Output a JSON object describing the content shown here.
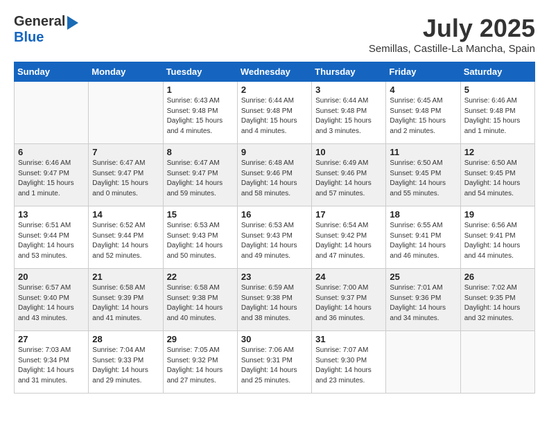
{
  "logo": {
    "general": "General",
    "blue": "Blue"
  },
  "title": {
    "month_year": "July 2025",
    "location": "Semillas, Castille-La Mancha, Spain"
  },
  "days_of_week": [
    "Sunday",
    "Monday",
    "Tuesday",
    "Wednesday",
    "Thursday",
    "Friday",
    "Saturday"
  ],
  "weeks": [
    [
      {
        "day": "",
        "info": ""
      },
      {
        "day": "",
        "info": ""
      },
      {
        "day": "1",
        "info": "Sunrise: 6:43 AM\nSunset: 9:48 PM\nDaylight: 15 hours\nand 4 minutes."
      },
      {
        "day": "2",
        "info": "Sunrise: 6:44 AM\nSunset: 9:48 PM\nDaylight: 15 hours\nand 4 minutes."
      },
      {
        "day": "3",
        "info": "Sunrise: 6:44 AM\nSunset: 9:48 PM\nDaylight: 15 hours\nand 3 minutes."
      },
      {
        "day": "4",
        "info": "Sunrise: 6:45 AM\nSunset: 9:48 PM\nDaylight: 15 hours\nand 2 minutes."
      },
      {
        "day": "5",
        "info": "Sunrise: 6:46 AM\nSunset: 9:48 PM\nDaylight: 15 hours\nand 1 minute."
      }
    ],
    [
      {
        "day": "6",
        "info": "Sunrise: 6:46 AM\nSunset: 9:47 PM\nDaylight: 15 hours\nand 1 minute."
      },
      {
        "day": "7",
        "info": "Sunrise: 6:47 AM\nSunset: 9:47 PM\nDaylight: 15 hours\nand 0 minutes."
      },
      {
        "day": "8",
        "info": "Sunrise: 6:47 AM\nSunset: 9:47 PM\nDaylight: 14 hours\nand 59 minutes."
      },
      {
        "day": "9",
        "info": "Sunrise: 6:48 AM\nSunset: 9:46 PM\nDaylight: 14 hours\nand 58 minutes."
      },
      {
        "day": "10",
        "info": "Sunrise: 6:49 AM\nSunset: 9:46 PM\nDaylight: 14 hours\nand 57 minutes."
      },
      {
        "day": "11",
        "info": "Sunrise: 6:50 AM\nSunset: 9:45 PM\nDaylight: 14 hours\nand 55 minutes."
      },
      {
        "day": "12",
        "info": "Sunrise: 6:50 AM\nSunset: 9:45 PM\nDaylight: 14 hours\nand 54 minutes."
      }
    ],
    [
      {
        "day": "13",
        "info": "Sunrise: 6:51 AM\nSunset: 9:44 PM\nDaylight: 14 hours\nand 53 minutes."
      },
      {
        "day": "14",
        "info": "Sunrise: 6:52 AM\nSunset: 9:44 PM\nDaylight: 14 hours\nand 52 minutes."
      },
      {
        "day": "15",
        "info": "Sunrise: 6:53 AM\nSunset: 9:43 PM\nDaylight: 14 hours\nand 50 minutes."
      },
      {
        "day": "16",
        "info": "Sunrise: 6:53 AM\nSunset: 9:43 PM\nDaylight: 14 hours\nand 49 minutes."
      },
      {
        "day": "17",
        "info": "Sunrise: 6:54 AM\nSunset: 9:42 PM\nDaylight: 14 hours\nand 47 minutes."
      },
      {
        "day": "18",
        "info": "Sunrise: 6:55 AM\nSunset: 9:41 PM\nDaylight: 14 hours\nand 46 minutes."
      },
      {
        "day": "19",
        "info": "Sunrise: 6:56 AM\nSunset: 9:41 PM\nDaylight: 14 hours\nand 44 minutes."
      }
    ],
    [
      {
        "day": "20",
        "info": "Sunrise: 6:57 AM\nSunset: 9:40 PM\nDaylight: 14 hours\nand 43 minutes."
      },
      {
        "day": "21",
        "info": "Sunrise: 6:58 AM\nSunset: 9:39 PM\nDaylight: 14 hours\nand 41 minutes."
      },
      {
        "day": "22",
        "info": "Sunrise: 6:58 AM\nSunset: 9:38 PM\nDaylight: 14 hours\nand 40 minutes."
      },
      {
        "day": "23",
        "info": "Sunrise: 6:59 AM\nSunset: 9:38 PM\nDaylight: 14 hours\nand 38 minutes."
      },
      {
        "day": "24",
        "info": "Sunrise: 7:00 AM\nSunset: 9:37 PM\nDaylight: 14 hours\nand 36 minutes."
      },
      {
        "day": "25",
        "info": "Sunrise: 7:01 AM\nSunset: 9:36 PM\nDaylight: 14 hours\nand 34 minutes."
      },
      {
        "day": "26",
        "info": "Sunrise: 7:02 AM\nSunset: 9:35 PM\nDaylight: 14 hours\nand 32 minutes."
      }
    ],
    [
      {
        "day": "27",
        "info": "Sunrise: 7:03 AM\nSunset: 9:34 PM\nDaylight: 14 hours\nand 31 minutes."
      },
      {
        "day": "28",
        "info": "Sunrise: 7:04 AM\nSunset: 9:33 PM\nDaylight: 14 hours\nand 29 minutes."
      },
      {
        "day": "29",
        "info": "Sunrise: 7:05 AM\nSunset: 9:32 PM\nDaylight: 14 hours\nand 27 minutes."
      },
      {
        "day": "30",
        "info": "Sunrise: 7:06 AM\nSunset: 9:31 PM\nDaylight: 14 hours\nand 25 minutes."
      },
      {
        "day": "31",
        "info": "Sunrise: 7:07 AM\nSunset: 9:30 PM\nDaylight: 14 hours\nand 23 minutes."
      },
      {
        "day": "",
        "info": ""
      },
      {
        "day": "",
        "info": ""
      }
    ]
  ]
}
